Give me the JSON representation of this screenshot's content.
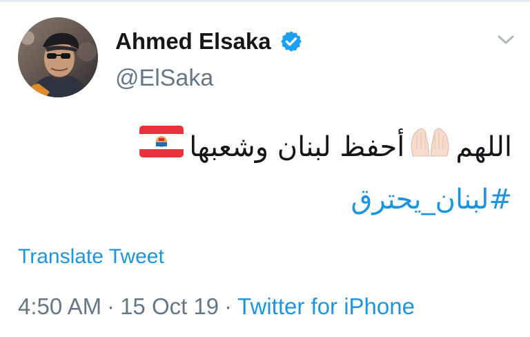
{
  "tweet": {
    "author": {
      "display_name": "Ahmed Elsaka",
      "handle": "@ElSaka",
      "verified": true
    },
    "text_part1": "اللهم",
    "text_part2": "أحفظ لبنان وشعبها",
    "emoji": [
      "folded-hands-icon",
      "french-polynesia-flag-icon"
    ],
    "hashtag": "#لبنان_يحترق",
    "translate_label": "Translate Tweet",
    "time": "4:50 AM",
    "date": "15 Oct 19",
    "separator": "·",
    "source": "Twitter for iPhone"
  },
  "colors": {
    "link": "#1b95e0",
    "secondary_text": "#657786",
    "primary_text": "#14171a",
    "verified_badge": "#1da1f2"
  }
}
